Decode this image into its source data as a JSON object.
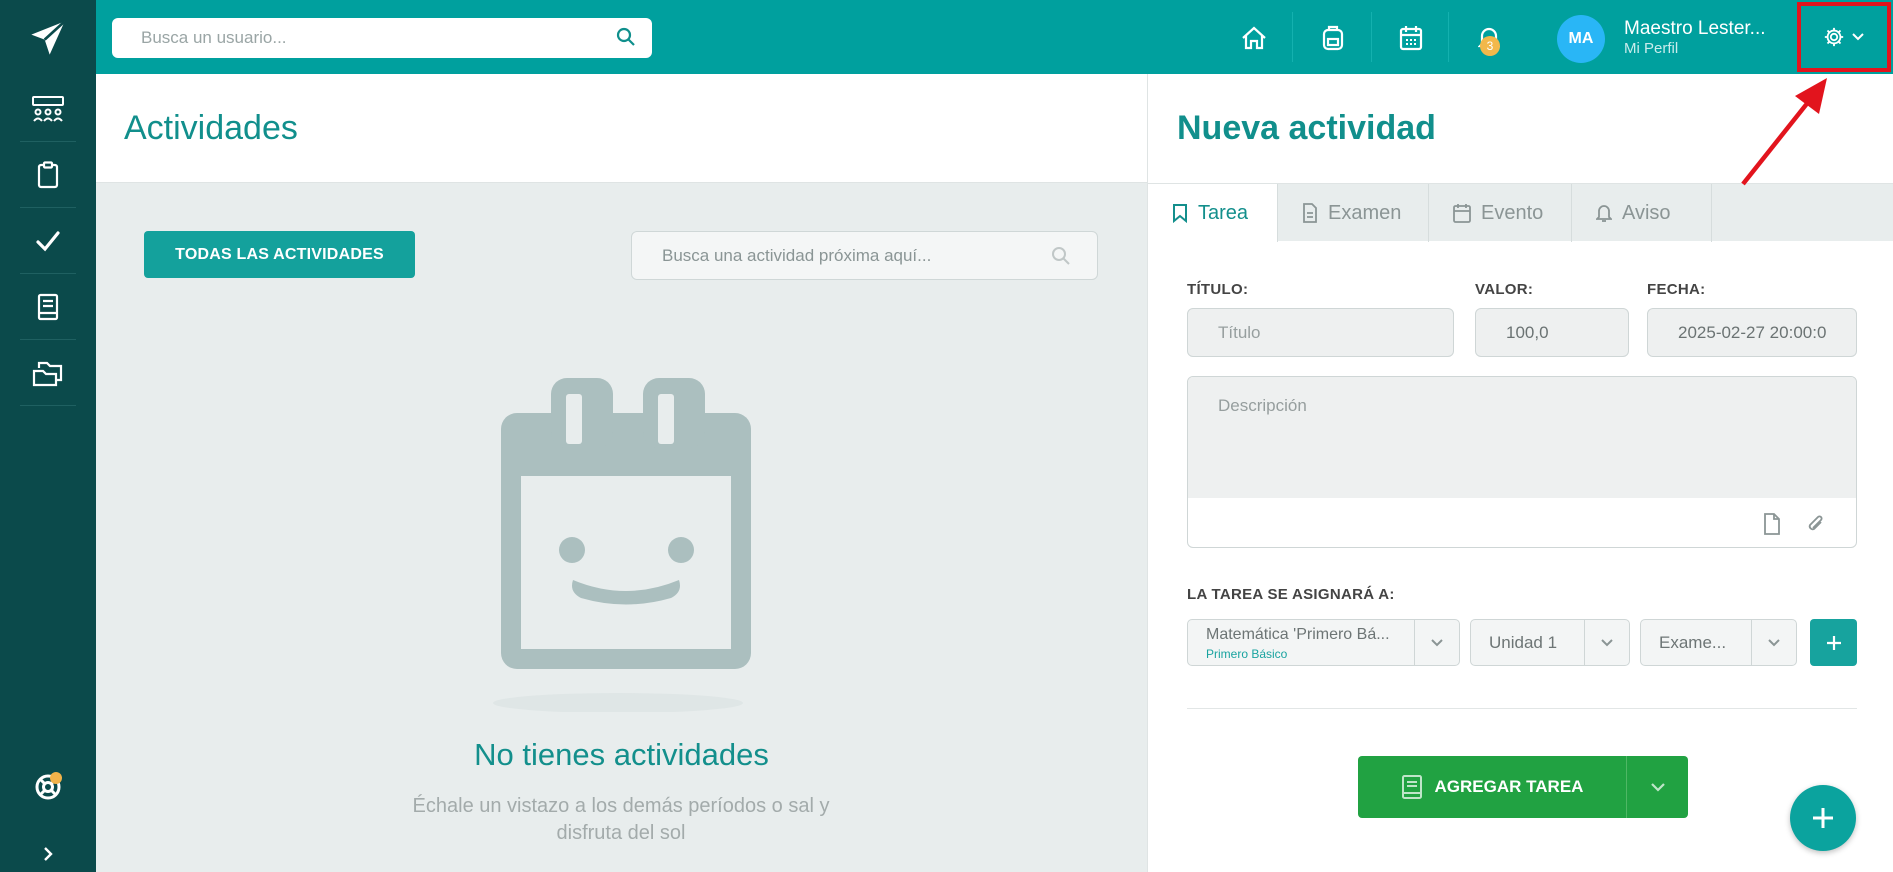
{
  "topbar": {
    "search_placeholder": "Busca un usuario...",
    "notification_count": "3",
    "avatar_initials": "MA",
    "user_name": "Maestro Lester...",
    "user_subtitle": "Mi Perfil"
  },
  "activities": {
    "title": "Actividades",
    "all_button": "TODAS LAS ACTIVIDADES",
    "search_placeholder": "Busca una actividad próxima aquí...",
    "empty_title": "No tienes actividades",
    "empty_subtitle": "Échale un vistazo a los demás períodos o sal y disfruta del sol"
  },
  "new_activity": {
    "title": "Nueva actividad",
    "tabs": [
      {
        "label": "Tarea",
        "icon": "bookmark-icon",
        "active": true
      },
      {
        "label": "Examen",
        "icon": "document-icon",
        "active": false
      },
      {
        "label": "Evento",
        "icon": "calendar-icon",
        "active": false
      },
      {
        "label": "Aviso",
        "icon": "bell-icon",
        "active": false
      }
    ],
    "title_label": "TÍTULO:",
    "title_placeholder": "Título",
    "value_label": "VALOR:",
    "value": "100,0",
    "date_label": "FECHA:",
    "date_value": "2025-02-27 20:00:0",
    "description_placeholder": "Descripción",
    "assign_label": "LA TAREA SE ASIGNARÁ A:",
    "course_value": "Matemática 'Primero Bá...",
    "course_sub": "Primero Básico",
    "unit_value": "Unidad 1",
    "type_value": "Exame...",
    "add_button": "AGREGAR TAREA"
  },
  "colors": {
    "sidebar": "#0b4a4b",
    "topbar": "#00a09e",
    "accent": "#138f8c",
    "add_button": "#21a242",
    "highlight_box": "#e2141d"
  }
}
